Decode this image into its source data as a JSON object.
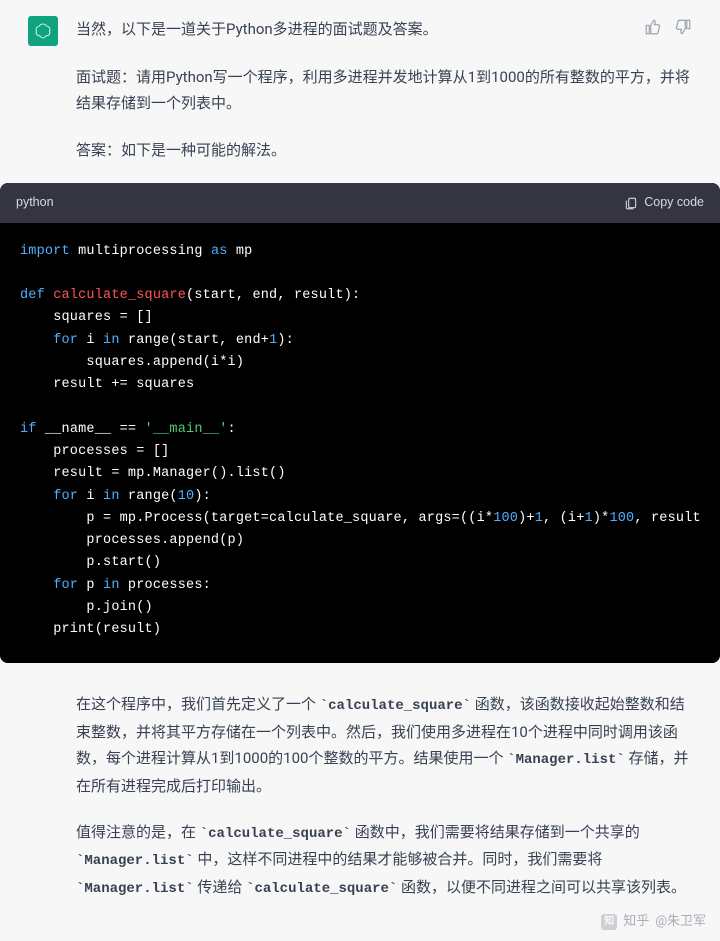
{
  "top_line": "当然，以下是一道关于Python多进程的面试题及答案。",
  "question": "面试题：请用Python写一个程序，利用多进程并发地计算从1到1000的所有整数的平方，并将结果存储到一个列表中。",
  "answer_label": "答案：如下是一种可能的解法。",
  "codebar": {
    "lang": "python",
    "copy": "Copy code"
  },
  "code": {
    "l1a": "import",
    "l1b": " multiprocessing ",
    "l1c": "as",
    "l1d": " mp",
    "l2a": "def",
    "l2b": " calculate_square",
    "l2c": "(start, end, result):",
    "l3": "    squares = []",
    "l4a": "    for",
    "l4b": " i ",
    "l4c": "in",
    "l4d": " range(start, end+",
    "l4e": "1",
    "l4f": "):",
    "l5": "        squares.append(i*i)",
    "l6": "    result += squares",
    "l7a": "if",
    "l7b": " __name__ == ",
    "l7c": "'__main__'",
    "l7d": ":",
    "l8": "    processes = []",
    "l9": "    result = mp.Manager().list()",
    "l10a": "    for",
    "l10b": " i ",
    "l10c": "in",
    "l10d": " range(",
    "l10e": "10",
    "l10f": "):",
    "l11a": "        p = mp.Process(target=calculate_square, args=((i*",
    "l11b": "100",
    "l11c": ")+",
    "l11d": "1",
    "l11e": ", (i+",
    "l11f": "1",
    "l11g": ")*",
    "l11h": "100",
    "l11i": ", result",
    "l12": "        processes.append(p)",
    "l13": "        p.start()",
    "l14a": "    for",
    "l14b": " p ",
    "l14c": "in",
    "l14d": " processes:",
    "l15": "        p.join()",
    "l16": "    print(result)"
  },
  "explain1_a": "在这个程序中，我们首先定义了一个 ",
  "explain1_code1": "`calculate_square`",
  "explain1_b": " 函数，该函数接收起始整数和结束整数，并将其平方存储在一个列表中。然后，我们使用多进程在10个进程中同时调用该函数，每个进程计算从1到1000的100个整数的平方。结果使用一个 ",
  "explain1_code2": "`Manager.list`",
  "explain1_c": " 存储，并在所有进程完成后打印输出。",
  "explain2_a": "值得注意的是，在 ",
  "explain2_code1": "`calculate_square`",
  "explain2_b": " 函数中，我们需要将结果存储到一个共享的 ",
  "explain2_code2": "`Manager.list`",
  "explain2_c": " 中，这样不同进程中的结果才能够被合并。同时，我们需要将 ",
  "explain2_code3": "`Manager.list`",
  "explain2_d": " 传递给 ",
  "explain2_code4": "`calculate_square`",
  "explain2_e": " 函数，以便不同进程之间可以共享该列表。",
  "watermark_site": "知乎",
  "watermark_user": "@朱卫军"
}
